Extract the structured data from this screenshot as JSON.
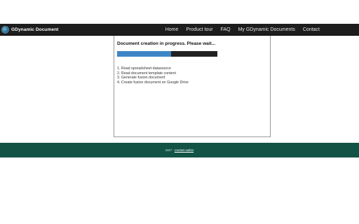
{
  "brand": {
    "name": "GDynamic Document",
    "logo_icon": "gdynamic-logo-icon"
  },
  "nav": {
    "items": [
      {
        "label": "Home"
      },
      {
        "label": "Product tour"
      },
      {
        "label": "FAQ"
      },
      {
        "label": "My GDynamic Documents"
      },
      {
        "label": "Contact"
      }
    ]
  },
  "status": {
    "title": "Document creation in progress. Please wait...",
    "progress_fraction": 0.54
  },
  "steps": [
    {
      "text": "1. Read spreadsheet datasource"
    },
    {
      "text": "2. Read document template content"
    },
    {
      "text": "3. Generate fusion document"
    },
    {
      "text": "4. Create fusion document on Google Drive"
    }
  ],
  "footer": {
    "year_text": "2017 - ",
    "contact_label": "Contact author"
  },
  "colors": {
    "navbar": "#1d1d1d",
    "progress_fill": "#3d86c6",
    "progress_track": "#222222",
    "footer": "#125346"
  }
}
